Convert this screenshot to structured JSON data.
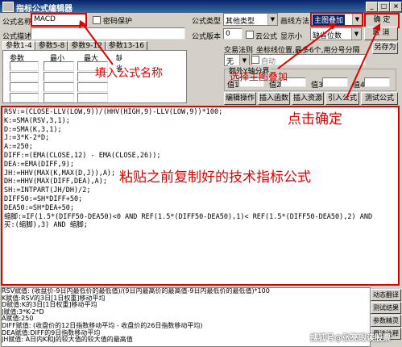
{
  "window": {
    "title": "指标公式编辑器",
    "minimize": "_",
    "maximize": "□",
    "close": "×"
  },
  "form": {
    "name_label": "公式名称",
    "name_value": "MACD",
    "password_label": "密码保护",
    "desc_label": "公式描述",
    "desc_value": "",
    "type_label": "公式类型",
    "type_value": "其他类型",
    "draw_label": "画线方法",
    "draw_value": "主图叠加",
    "version_label": "公式版本",
    "version_value": "0",
    "cloud_label": "云公式",
    "display_label": "显示小",
    "decimal_value": "缺省位数",
    "trade_label": "交易法则",
    "trade_value": "无",
    "coord_text": "坐标线位置,最多6个,用分号分隔",
    "auto_label": "自动",
    "value_range_label": "额外Y轴分界",
    "values": [
      "值1",
      "值2",
      "值3",
      "值4"
    ]
  },
  "buttons": {
    "ok": "确 定",
    "cancel": "取 消",
    "save_as": "另存为",
    "edit": "编辑操作",
    "insert_func": "插入函数",
    "insert_res": "插入资源",
    "import": "引入公式",
    "test": "测试公式"
  },
  "tabs": [
    "参数1-4",
    "参数5-8",
    "参数9-12",
    "参数13-16"
  ],
  "param_headers": [
    "参数",
    "最小",
    "最大",
    "缺省"
  ],
  "annotations": {
    "fill_name": "填入公式名称",
    "choose_overlay": "选择主图叠加",
    "click_ok": "点击确定",
    "paste_code": "粘贴之前复制好的技术指标公式"
  },
  "code_lines": [
    "RSV:=(CLOSE-LLV(LOW,9))/(HHV(HIGH,9)-LLV(LOW,9))*100;",
    "K:=SMA(RSV,3,1);",
    "D:=SMA(K,3,1);",
    "J:=3*K-2*D;",
    "A:=250;",
    "DIFF:=(EMA(CLOSE,12) - EMA(CLOSE,26));",
    "DEA:=EMA(DIFF,9);",
    "JH:=HHV(MAX(K,MAX(D,J)),A);",
    "DH:=HHV(MAX(DIFF,DEA),A);",
    "SH:=INTPART(JH/DH)/2;",
    "DIFF50:=SH*DIFF+50;",
    "DEA50:=SH*DEA+50;",
    "缩脚:=IF(1.5*(DIFF50-DEA50)<0 AND REF(1.5*(DIFF50-DEA50),1)< REF(1.5*(DIFF50-DEA50),2) AND",
    "买:(缩脚),3) AND 缩脚;"
  ],
  "help_lines": [
    "RSV赋值: (收盘价-9日内最低价的最低值)/(9日内最高价的最高值-9日内最低价的最低值)*100",
    "K赋值:RSV的3日[1日权重]移动平均",
    "D赋值:K的3日[1日权重]移动平均",
    "J赋值:3*K-2*D",
    "A赋值:250",
    "DIFF赋值: (收盘价的12日指数移动平均 - 收盘价的26日指数移动平均)",
    "DEA赋值:DIFF的9日指数移动平均",
    "JH赋值: A日内K和J的较大值的较大值的最高值"
  ],
  "side_buttons": [
    "动态翻译",
    "测试结果",
    "参数精灵",
    "用法注释"
  ],
  "watermark": "搜狐号@张亮眼读股票"
}
